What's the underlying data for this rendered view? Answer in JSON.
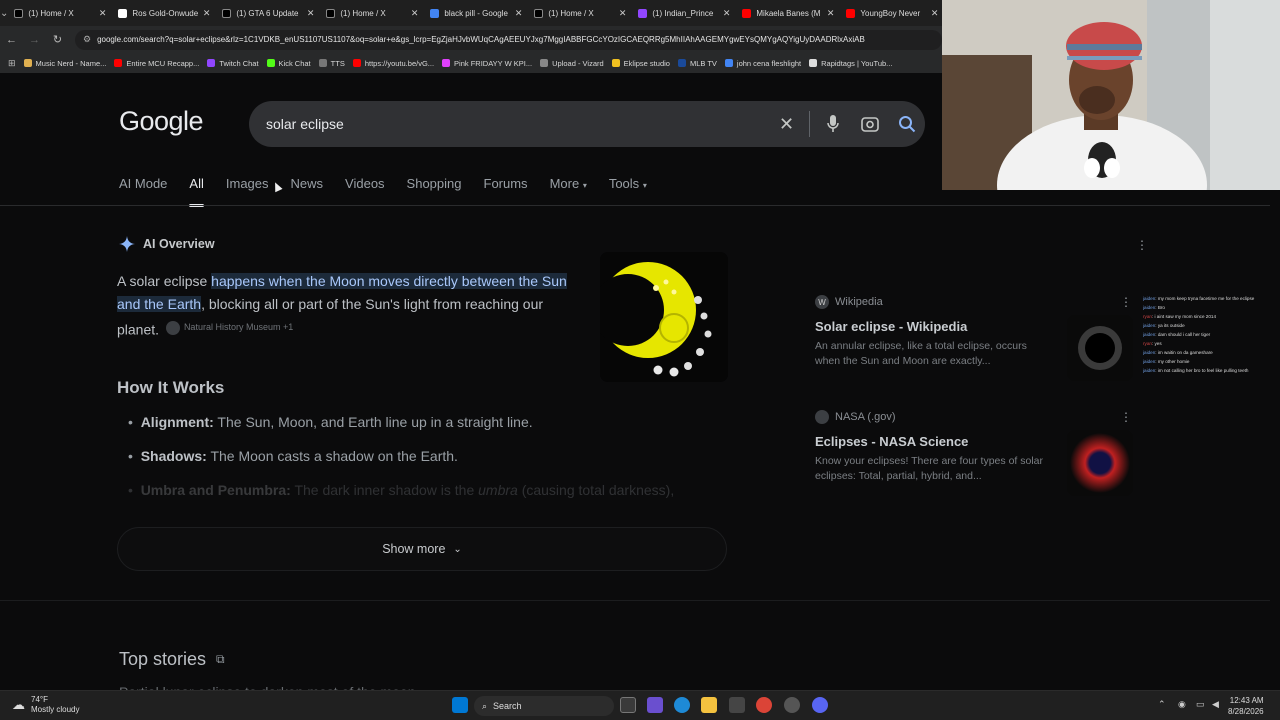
{
  "browser": {
    "tabs": [
      {
        "title": "(1) Home / X",
        "icon": "x-logo-icon",
        "color": "#000000"
      },
      {
        "title": "Ros Gold-Onwude",
        "icon": "wikipedia-icon",
        "color": "#ffffff"
      },
      {
        "title": "(1) GTA 6 Update",
        "icon": "x-logo-icon",
        "color": "#000000"
      },
      {
        "title": "(1) Home / X",
        "icon": "x-logo-icon",
        "color": "#000000"
      },
      {
        "title": "black pill - Google",
        "icon": "google-icon",
        "color": "#4285f4"
      },
      {
        "title": "(1) Home / X",
        "icon": "x-logo-icon",
        "color": "#000000"
      },
      {
        "title": "(1) Indian_Prince",
        "icon": "twitch-icon",
        "color": "#9146ff"
      },
      {
        "title": "Mikaela Banes (M",
        "icon": "youtube-icon",
        "color": "#ff0000"
      },
      {
        "title": "YoungBoy Never",
        "icon": "youtube-icon",
        "color": "#ff0000"
      }
    ],
    "url": "google.com/search?q=solar+eclipse&rlz=1C1VDKB_enUS1107US1107&oq=solar+e&gs_lcrp=EgZjaHJvbWUqCAgAEEUYJxg7MggIABBFGCcYOzIGCAEQRRg5MhIIAhAAGEMYgwEYsQMYgAQYigUyDAADRlxAxiAB",
    "bookmarks": [
      {
        "label": "Music Nerd - Name...",
        "color": "#e0b050"
      },
      {
        "label": "Entire MCU Recapp...",
        "color": "#ff0000"
      },
      {
        "label": "Twitch Chat",
        "color": "#9146ff"
      },
      {
        "label": "Kick Chat",
        "color": "#53fc18"
      },
      {
        "label": "TTS",
        "color": "#777777"
      },
      {
        "label": "https://youtu.be/vG...",
        "color": "#ff0000"
      },
      {
        "label": "Pink FRIDAYY W KPI...",
        "color": "#e040fb"
      },
      {
        "label": "Upload - Vizard",
        "color": "#888888"
      },
      {
        "label": "Eklipse studio",
        "color": "#f0c020"
      },
      {
        "label": "MLB TV",
        "color": "#1a4a9a"
      },
      {
        "label": "john cena fleshlight",
        "color": "#4285f4"
      },
      {
        "label": "Rapidtags | YouTub...",
        "color": "#dddddd"
      }
    ]
  },
  "search": {
    "logo": "Google",
    "query": "solar eclipse"
  },
  "tabs": [
    "AI Mode",
    "All",
    "Images",
    "News",
    "Videos",
    "Shopping",
    "Forums",
    "More",
    "Tools"
  ],
  "ai_overview": {
    "label": "AI Overview",
    "intro": "A solar eclipse ",
    "highlight": "happens when the Moon moves directly between the Sun and the Earth",
    "rest": ", blocking all or part of the Sun's light from reaching our planet.",
    "citation": "Natural History Museum +1",
    "how_title": "How It Works",
    "bullets": [
      {
        "term": "Alignment:",
        "text": " The Sun, Moon, and Earth line up in a straight line."
      },
      {
        "term": "Shadows:",
        "text": " The Moon casts a shadow on the Earth."
      },
      {
        "term": "Umbra and Penumbra:",
        "text": " The dark inner shadow is the ",
        "em": "umbra",
        "tail": " (causing total darkness),"
      }
    ],
    "show_more": "Show more"
  },
  "sources": [
    {
      "site": "Wikipedia",
      "title": "Solar eclipse - Wikipedia",
      "snippet": "An annular eclipse, like a total eclipse, occurs when the Sun and Moon are exactly..."
    },
    {
      "site": "NASA (.gov)",
      "title": "Eclipses - NASA Science",
      "snippet": "Know your eclipses! There are four types of solar eclipses: Total, partial, hybrid, and..."
    }
  ],
  "top_stories": {
    "title": "Top stories",
    "first": "Partial lunar eclipse to darken most of the moon"
  },
  "chat": [
    {
      "user": "jaiden",
      "msg": ": my mom keep tryna facetime me for the eclipse"
    },
    {
      "user": "jaiden",
      "msg": ": Bro"
    },
    {
      "user": "ryan",
      "msg": ": i aint saw my mom since 2014"
    },
    {
      "user": "jaiden",
      "msg": ": ya its outside"
    },
    {
      "user": "jaiden",
      "msg": ": dam should i call her tiger"
    },
    {
      "user": "ryan",
      "msg": ": yes"
    },
    {
      "user": "jaiden",
      "msg": ": im waitin on da gameshare"
    },
    {
      "user": "jaiden",
      "msg": ": my other homie"
    },
    {
      "user": "jaiden",
      "msg": ": im not calling her bro to feel like pulling teeth"
    }
  ],
  "taskbar": {
    "temp": "74°F",
    "weather": "Mostly cloudy",
    "search": "Search",
    "time": "12:43 AM",
    "date": "8/28/2026"
  }
}
